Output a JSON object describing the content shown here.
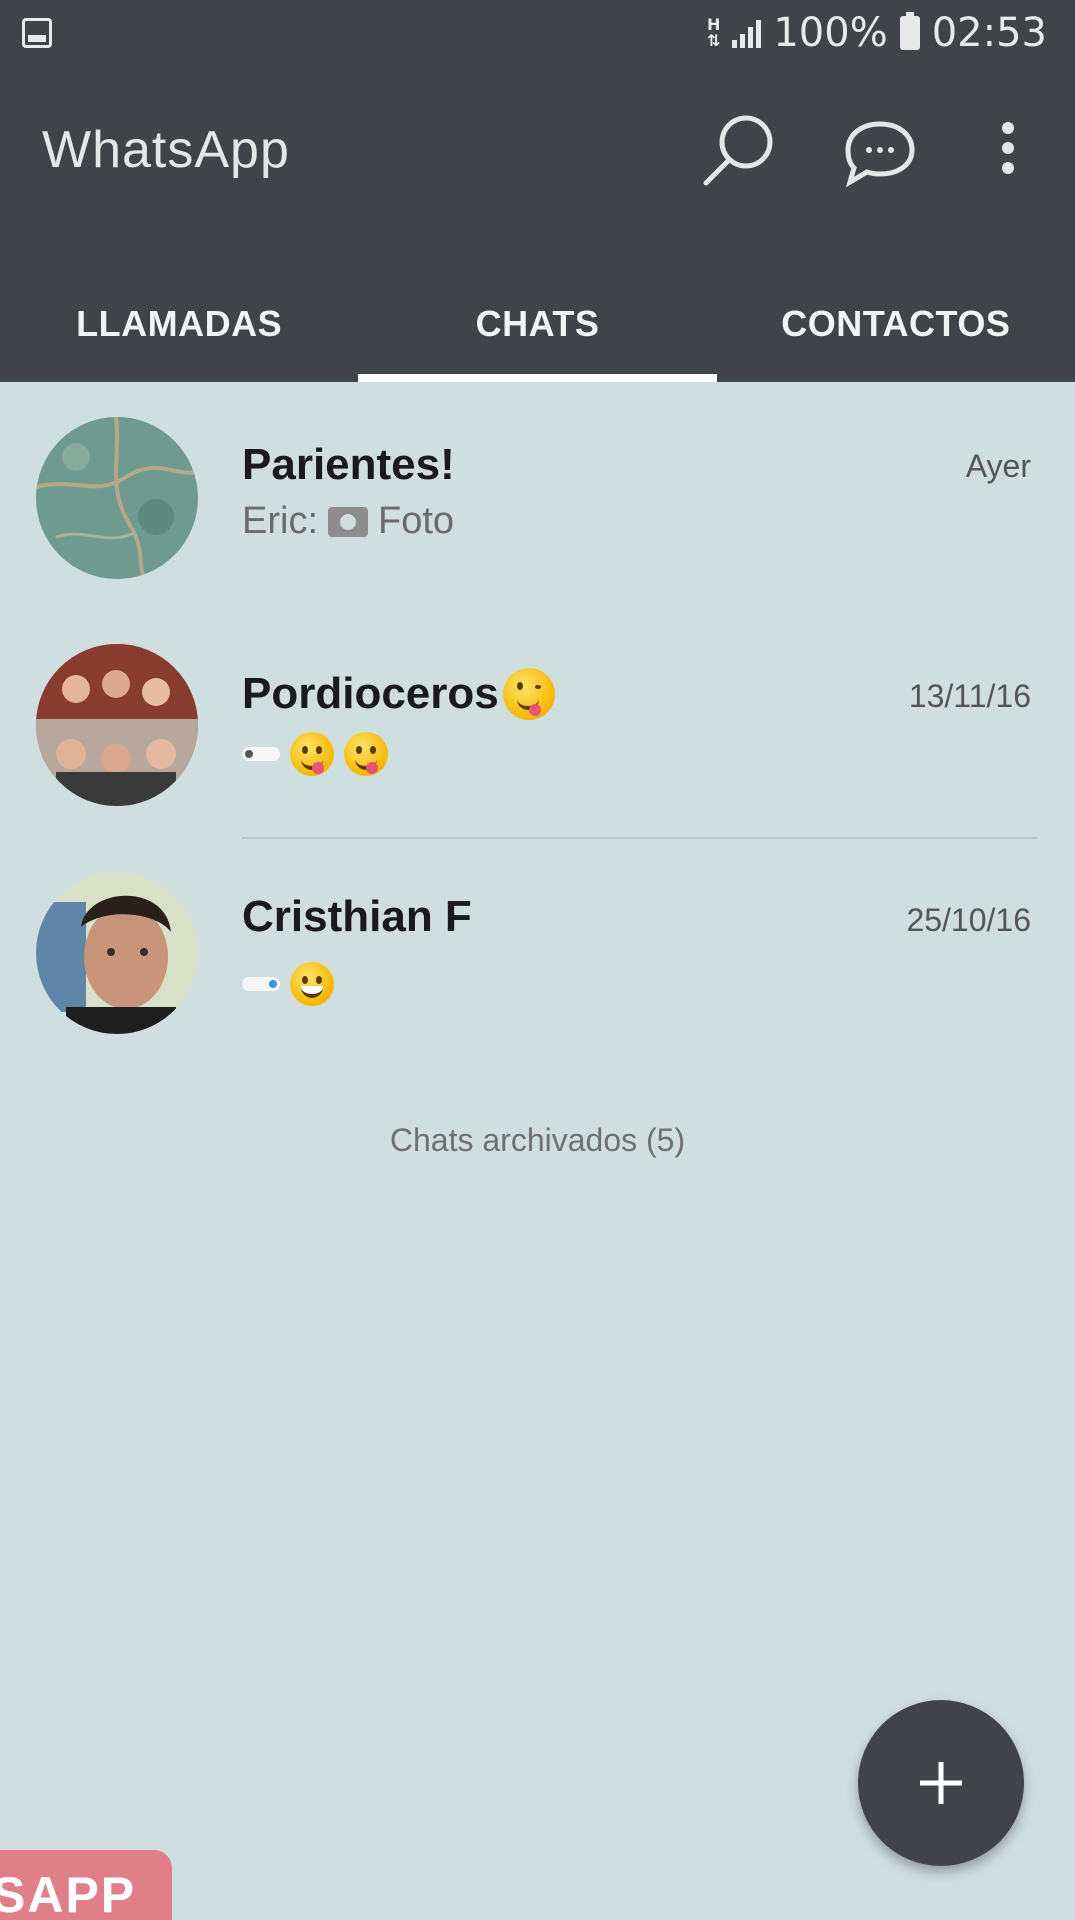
{
  "status_bar": {
    "network": "H",
    "battery": "100%",
    "time": "02:53"
  },
  "app": {
    "title": "WhatsApp"
  },
  "tabs": [
    {
      "label": "LLAMADAS",
      "active": false
    },
    {
      "label": "CHATS",
      "active": true
    },
    {
      "label": "CONTACTOS",
      "active": false
    }
  ],
  "chats": [
    {
      "name": "Parientes!",
      "time": "Ayer",
      "sender": "Eric:",
      "preview": "Foto"
    },
    {
      "name": "Pordioceros",
      "time": "13/11/16"
    },
    {
      "name": "Cristhian F",
      "time": "25/10/16"
    }
  ],
  "archived_label": "Chats archivados (5)",
  "badge_text": "SAPP",
  "colors": {
    "header": "#404347",
    "background": "#cfdfe0",
    "fab": "#404347",
    "badge": "#e07f89"
  }
}
